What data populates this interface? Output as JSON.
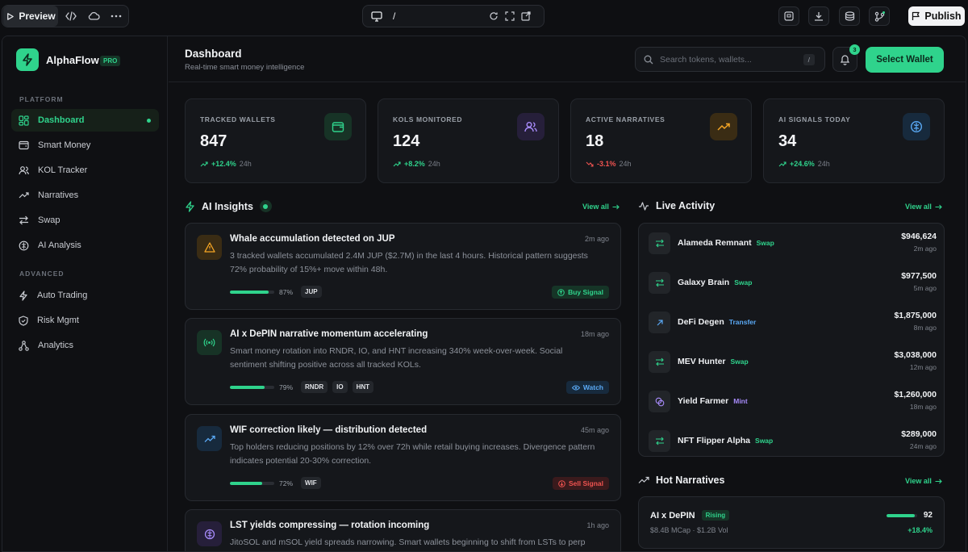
{
  "toolbar": {
    "preview_label": "Preview",
    "url_path": "/",
    "publish_label": "Publish"
  },
  "sidebar": {
    "brand": "AlphaFlow",
    "badge": "PRO",
    "platform_label": "PLATFORM",
    "advanced_label": "ADVANCED",
    "items": [
      {
        "label": "Dashboard",
        "icon": "grid-icon"
      },
      {
        "label": "Smart Money",
        "icon": "wallet-icon"
      },
      {
        "label": "KOL Tracker",
        "icon": "users-icon"
      },
      {
        "label": "Narratives",
        "icon": "trend-icon"
      },
      {
        "label": "Swap",
        "icon": "swap-icon"
      },
      {
        "label": "AI Analysis",
        "icon": "cpu-icon"
      }
    ],
    "advanced_items": [
      {
        "label": "Auto Trading",
        "icon": "bolt-icon"
      },
      {
        "label": "Risk Mgmt",
        "icon": "shield-icon"
      },
      {
        "label": "Analytics",
        "icon": "network-icon"
      }
    ]
  },
  "header": {
    "title": "Dashboard",
    "subtitle": "Real-time smart money intelligence",
    "search_placeholder": "Search tokens, wallets...",
    "search_kbd": "/",
    "notif_count": "3",
    "wallet_button": "Select Wallet"
  },
  "stats": [
    {
      "label": "TRACKED WALLETS",
      "value": "847",
      "change": "+12.4%",
      "period": "24h",
      "color": "#2fd38c"
    },
    {
      "label": "KOLS MONITORED",
      "value": "124",
      "change": "+8.2%",
      "period": "24h",
      "color": "#2fd38c"
    },
    {
      "label": "ACTIVE NARRATIVES",
      "value": "18",
      "change": "-3.1%",
      "period": "24h",
      "color": "#ef5350"
    },
    {
      "label": "AI SIGNALS TODAY",
      "value": "34",
      "change": "+24.6%",
      "period": "24h",
      "color": "#2fd38c"
    }
  ],
  "insights": {
    "title": "AI Insights",
    "view_all": "View all",
    "cards": [
      {
        "title": "Whale accumulation detected on JUP",
        "time": "2m ago",
        "body": "3 tracked wallets accumulated 2.4M JUP ($2.7M) in the last 4 hours. Historical pattern suggests 72% probability of 15%+ move within 48h.",
        "confidence": "87%",
        "confidence_value": 0.87,
        "tags": [
          "JUP"
        ],
        "signal": "Buy Signal"
      },
      {
        "title": "AI x DePIN narrative momentum accelerating",
        "time": "18m ago",
        "body": "Smart money rotation into RNDR, IO, and HNT increasing 340% week-over-week. Social sentiment shifting positive across all tracked KOLs.",
        "confidence": "79%",
        "confidence_value": 0.79,
        "tags": [
          "RNDR",
          "IO",
          "HNT"
        ],
        "signal": "Watch"
      },
      {
        "title": "WIF correction likely — distribution detected",
        "time": "45m ago",
        "body": "Top holders reducing positions by 12% over 72h while retail buying increases. Divergence pattern indicates potential 20-30% correction.",
        "confidence": "72%",
        "confidence_value": 0.72,
        "tags": [
          "WIF"
        ],
        "signal": "Sell Signal"
      },
      {
        "title": "LST yields compressing — rotation incoming",
        "time": "1h ago",
        "body": "JitoSOL and mSOL yield spreads narrowing. Smart wallets beginning to shift from LSTs to perp"
      }
    ]
  },
  "activity": {
    "title": "Live Activity",
    "view_all": "View all",
    "rows": [
      {
        "name": "Alameda Remnant",
        "type": "Swap",
        "amount": "$946,624",
        "time": "2m ago"
      },
      {
        "name": "Galaxy Brain",
        "type": "Swap",
        "amount": "$977,500",
        "time": "5m ago"
      },
      {
        "name": "DeFi Degen",
        "type": "Transfer",
        "amount": "$1,875,000",
        "time": "8m ago"
      },
      {
        "name": "MEV Hunter",
        "type": "Swap",
        "amount": "$3,038,000",
        "time": "12m ago"
      },
      {
        "name": "Yield Farmer",
        "type": "Mint",
        "amount": "$1,260,000",
        "time": "18m ago"
      },
      {
        "name": "NFT Flipper Alpha",
        "type": "Swap",
        "amount": "$289,000",
        "time": "24m ago"
      }
    ]
  },
  "narratives": {
    "title": "Hot Narratives",
    "view_all": "View all",
    "items": [
      {
        "name": "AI x DePIN",
        "status": "Rising",
        "meta": "$8.4B MCap · $1.2B Vol",
        "score": "92",
        "score_value": 92,
        "change": "+18.4%"
      }
    ]
  }
}
